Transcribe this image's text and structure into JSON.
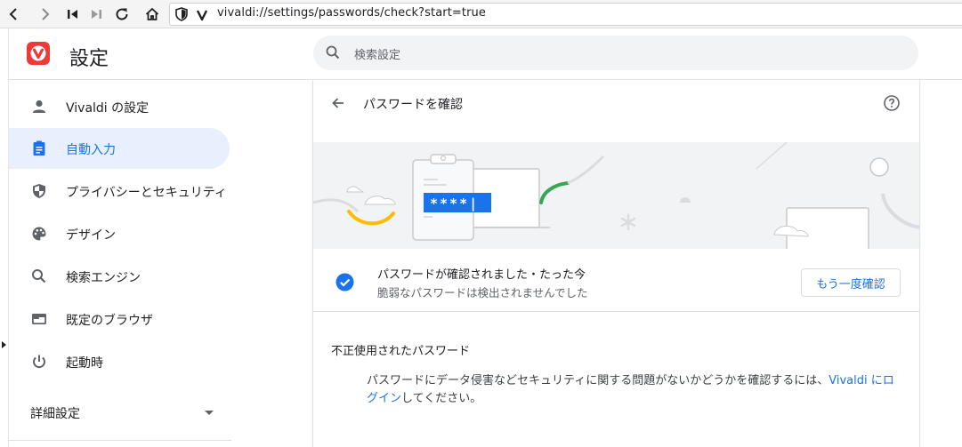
{
  "browser": {
    "url": "vivaldi://settings/passwords/check?start=true",
    "icons": [
      "back-icon",
      "forward-icon",
      "rewind-icon",
      "fast-forward-icon",
      "reload-icon",
      "home-icon",
      "shield-icon",
      "vivaldi-icon"
    ]
  },
  "header": {
    "title": "設定",
    "search_placeholder": "検索設定"
  },
  "sidebar": {
    "items": [
      {
        "label": "Vivaldi の設定",
        "icon": "person-icon",
        "active": false
      },
      {
        "label": "自動入力",
        "icon": "clipboard-icon",
        "active": true
      },
      {
        "label": "プライバシーとセキュリティ",
        "icon": "shield-icon",
        "active": false
      },
      {
        "label": "デザイン",
        "icon": "palette-icon",
        "active": false
      },
      {
        "label": "検索エンジン",
        "icon": "search-icon",
        "active": false
      },
      {
        "label": "既定のブラウザ",
        "icon": "browser-window-icon",
        "active": false
      },
      {
        "label": "起動時",
        "icon": "power-icon",
        "active": false
      }
    ],
    "advanced_label": "詳細設定"
  },
  "main": {
    "title": "パスワードを確認",
    "illustration_text": "****|",
    "status": {
      "title": "パスワードが確認されました・たった今",
      "subtitle": "脆弱なパスワードは検出されませんでした"
    },
    "recheck_label": "もう一度確認",
    "compromised": {
      "label": "不正使用されたパスワード",
      "text_before": "パスワードにデータ侵害などセキュリティに関する問題がないかどうかを確認するには、",
      "link": "Vivaldi にログイン",
      "text_after": "してください。"
    }
  },
  "colors": {
    "accent": "#1a73e8",
    "active_bg": "#e8f0fe",
    "logo_red": "#ef3939",
    "banner_bg": "#f1f3f4"
  }
}
